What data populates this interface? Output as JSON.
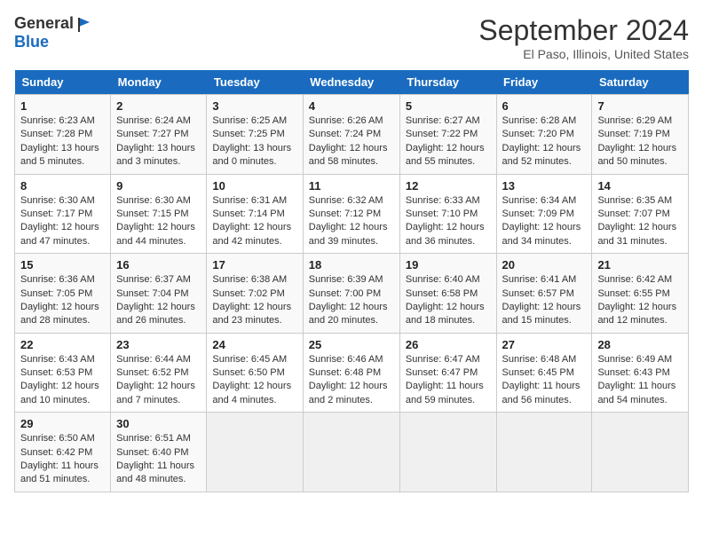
{
  "logo": {
    "general": "General",
    "blue": "Blue"
  },
  "title": "September 2024",
  "location": "El Paso, Illinois, United States",
  "days_of_week": [
    "Sunday",
    "Monday",
    "Tuesday",
    "Wednesday",
    "Thursday",
    "Friday",
    "Saturday"
  ],
  "weeks": [
    [
      {
        "day": "1",
        "sunrise": "6:23 AM",
        "sunset": "7:28 PM",
        "daylight": "13 hours and 5 minutes."
      },
      {
        "day": "2",
        "sunrise": "6:24 AM",
        "sunset": "7:27 PM",
        "daylight": "13 hours and 3 minutes."
      },
      {
        "day": "3",
        "sunrise": "6:25 AM",
        "sunset": "7:25 PM",
        "daylight": "13 hours and 0 minutes."
      },
      {
        "day": "4",
        "sunrise": "6:26 AM",
        "sunset": "7:24 PM",
        "daylight": "12 hours and 58 minutes."
      },
      {
        "day": "5",
        "sunrise": "6:27 AM",
        "sunset": "7:22 PM",
        "daylight": "12 hours and 55 minutes."
      },
      {
        "day": "6",
        "sunrise": "6:28 AM",
        "sunset": "7:20 PM",
        "daylight": "12 hours and 52 minutes."
      },
      {
        "day": "7",
        "sunrise": "6:29 AM",
        "sunset": "7:19 PM",
        "daylight": "12 hours and 50 minutes."
      }
    ],
    [
      {
        "day": "8",
        "sunrise": "6:30 AM",
        "sunset": "7:17 PM",
        "daylight": "12 hours and 47 minutes."
      },
      {
        "day": "9",
        "sunrise": "6:30 AM",
        "sunset": "7:15 PM",
        "daylight": "12 hours and 44 minutes."
      },
      {
        "day": "10",
        "sunrise": "6:31 AM",
        "sunset": "7:14 PM",
        "daylight": "12 hours and 42 minutes."
      },
      {
        "day": "11",
        "sunrise": "6:32 AM",
        "sunset": "7:12 PM",
        "daylight": "12 hours and 39 minutes."
      },
      {
        "day": "12",
        "sunrise": "6:33 AM",
        "sunset": "7:10 PM",
        "daylight": "12 hours and 36 minutes."
      },
      {
        "day": "13",
        "sunrise": "6:34 AM",
        "sunset": "7:09 PM",
        "daylight": "12 hours and 34 minutes."
      },
      {
        "day": "14",
        "sunrise": "6:35 AM",
        "sunset": "7:07 PM",
        "daylight": "12 hours and 31 minutes."
      }
    ],
    [
      {
        "day": "15",
        "sunrise": "6:36 AM",
        "sunset": "7:05 PM",
        "daylight": "12 hours and 28 minutes."
      },
      {
        "day": "16",
        "sunrise": "6:37 AM",
        "sunset": "7:04 PM",
        "daylight": "12 hours and 26 minutes."
      },
      {
        "day": "17",
        "sunrise": "6:38 AM",
        "sunset": "7:02 PM",
        "daylight": "12 hours and 23 minutes."
      },
      {
        "day": "18",
        "sunrise": "6:39 AM",
        "sunset": "7:00 PM",
        "daylight": "12 hours and 20 minutes."
      },
      {
        "day": "19",
        "sunrise": "6:40 AM",
        "sunset": "6:58 PM",
        "daylight": "12 hours and 18 minutes."
      },
      {
        "day": "20",
        "sunrise": "6:41 AM",
        "sunset": "6:57 PM",
        "daylight": "12 hours and 15 minutes."
      },
      {
        "day": "21",
        "sunrise": "6:42 AM",
        "sunset": "6:55 PM",
        "daylight": "12 hours and 12 minutes."
      }
    ],
    [
      {
        "day": "22",
        "sunrise": "6:43 AM",
        "sunset": "6:53 PM",
        "daylight": "12 hours and 10 minutes."
      },
      {
        "day": "23",
        "sunrise": "6:44 AM",
        "sunset": "6:52 PM",
        "daylight": "12 hours and 7 minutes."
      },
      {
        "day": "24",
        "sunrise": "6:45 AM",
        "sunset": "6:50 PM",
        "daylight": "12 hours and 4 minutes."
      },
      {
        "day": "25",
        "sunrise": "6:46 AM",
        "sunset": "6:48 PM",
        "daylight": "12 hours and 2 minutes."
      },
      {
        "day": "26",
        "sunrise": "6:47 AM",
        "sunset": "6:47 PM",
        "daylight": "11 hours and 59 minutes."
      },
      {
        "day": "27",
        "sunrise": "6:48 AM",
        "sunset": "6:45 PM",
        "daylight": "11 hours and 56 minutes."
      },
      {
        "day": "28",
        "sunrise": "6:49 AM",
        "sunset": "6:43 PM",
        "daylight": "11 hours and 54 minutes."
      }
    ],
    [
      {
        "day": "29",
        "sunrise": "6:50 AM",
        "sunset": "6:42 PM",
        "daylight": "11 hours and 51 minutes."
      },
      {
        "day": "30",
        "sunrise": "6:51 AM",
        "sunset": "6:40 PM",
        "daylight": "11 hours and 48 minutes."
      },
      null,
      null,
      null,
      null,
      null
    ]
  ],
  "labels": {
    "sunrise": "Sunrise: ",
    "sunset": "Sunset: ",
    "daylight": "Daylight: "
  }
}
